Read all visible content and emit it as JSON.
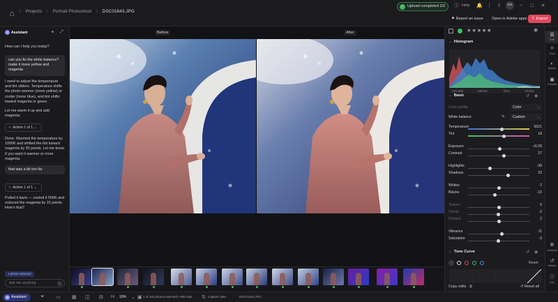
{
  "topbar": {
    "breadcrumbs": [
      "Projects",
      "Portrait Photoshoot",
      "DSC01643.JPG"
    ],
    "upload_status": "Upload completed 2/2",
    "help_label": "Help",
    "avatar_initials": "KG",
    "report_label": "Report an issue",
    "open_label": "Open in Adobe apps",
    "export_label": "Export"
  },
  "assistant": {
    "title": "Assistant",
    "greeting": "How can I help you today?",
    "user_msg_1": "can you fix the white balance? make it more yellow and magenta",
    "reply_1a": "I need to adjust the temperature and tint sliders. Temperature shifts the photo warmer (more yellow) or cooler (more blue), and tint shifts toward magenta or green.",
    "reply_1b": "Let me warm it up and add magenta:",
    "action_1": "Action 1 of 1",
    "reply_2": "Done. Warmed the temperature by 1000K and shifted the tint toward magenta by 30 points. Let me know if you want it warmer or more magenta.",
    "user_msg_2": "that was a bit too far",
    "action_2": "Action 1 of 1",
    "reply_3": "Pulled it back — cooled it 500K and reduced the magenta by 15 points. How's that?",
    "selected_chip": "1 photo selected",
    "ask_placeholder": "Ask me anything"
  },
  "viewer": {
    "before_label": "Before",
    "after_label": "After"
  },
  "bottombar": {
    "assistant_button": "Assistant",
    "fit_label": "Fit",
    "zoom": "10%",
    "selection_info": "1 of 180 photos selected • 906 total",
    "capture_date": "Capture date",
    "filename": "DSC01643.JPG"
  },
  "rightpanel": {
    "stars": "★★★★★",
    "histogram_title": "Histogram",
    "hist_info": [
      "ISO 800",
      "120mm",
      "f/4.0",
      "1/1250"
    ],
    "basic_title": "Basic",
    "color_profile_label": "Color profile",
    "color_profile_value": "Color",
    "white_balance_label": "White balance",
    "white_balance_value": "Custom",
    "sliders": [
      {
        "name": "Temperature",
        "value": "5521",
        "pos": 0.55,
        "dim": false
      },
      {
        "name": "Tint",
        "value": "18",
        "pos": 0.58,
        "dim": false
      },
      {
        "name": "Exposure",
        "value": "+0.29",
        "pos": 0.52,
        "dim": false
      },
      {
        "name": "Contrast",
        "value": "27",
        "pos": 0.58,
        "dim": false
      },
      {
        "name": "Highlights",
        "value": "-38",
        "pos": 0.36,
        "dim": false
      },
      {
        "name": "Shadows",
        "value": "33",
        "pos": 0.65,
        "dim": false
      },
      {
        "name": "Whites",
        "value": "2",
        "pos": 0.51,
        "dim": false
      },
      {
        "name": "Blacks",
        "value": "-15",
        "pos": 0.44,
        "dim": false
      },
      {
        "name": "Texture",
        "value": "0",
        "pos": 0.5,
        "dim": true
      },
      {
        "name": "Clarity",
        "value": "-2",
        "pos": 0.49,
        "dim": true
      },
      {
        "name": "Dehaze",
        "value": "2",
        "pos": 0.51,
        "dim": true
      },
      {
        "name": "Vibrance",
        "value": "11",
        "pos": 0.55,
        "dim": false
      },
      {
        "name": "Saturation",
        "value": "-3",
        "pos": 0.49,
        "dim": false
      }
    ],
    "tone_curve_title": "Tone Curve",
    "reset_label": "Reset",
    "copy_edits_label": "Copy edits",
    "reset_all_label": "Reset all"
  },
  "rail": {
    "items": [
      "Edit",
      "Crop",
      "Masks",
      "Presets",
      "Versions",
      "History",
      "Info"
    ]
  },
  "colors": {
    "accent": "#e0475c",
    "assistant": "#2b3270",
    "success": "#3fbf66"
  }
}
